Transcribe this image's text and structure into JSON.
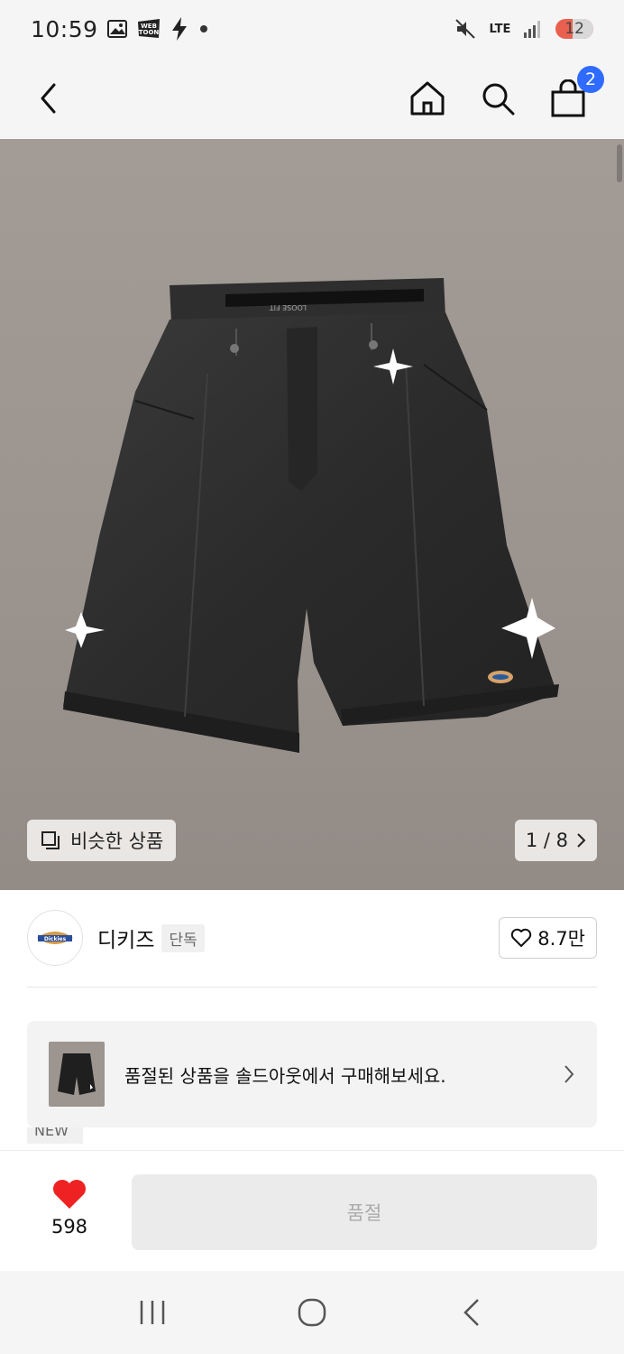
{
  "status_bar": {
    "time": "10:59",
    "network": "LTE",
    "battery": "12",
    "icons": [
      "gallery-icon",
      "webtoon-icon",
      "bolt-icon",
      "dot-icon",
      "mute-icon",
      "signal-icon",
      "battery-icon"
    ],
    "webtoon_label": "WEB TOON"
  },
  "app_bar": {
    "cart_count": "2",
    "icons": [
      "back-arrow-icon",
      "home-icon",
      "search-icon",
      "shopping-bag-icon"
    ]
  },
  "hero": {
    "similar_label": "비슷한 상품",
    "page_indicator": "1 / 8",
    "product_image": "black-work-shorts-with-star-embroidery"
  },
  "brand": {
    "name": "디키즈",
    "tag": "단독",
    "likes": "8.7만",
    "logo_text": "Dickies"
  },
  "soldout_banner": {
    "text": "품절된 상품을 솔드아웃에서 구매해보세요."
  },
  "new_tag": "NEW",
  "bottom_bar": {
    "wish_count": "598",
    "button_label": "품절"
  },
  "colors": {
    "accent_badge": "#2f6bff",
    "heart_red": "#ee2222",
    "hero_bg": "#a19a94",
    "battery_low": "#e9604f"
  }
}
